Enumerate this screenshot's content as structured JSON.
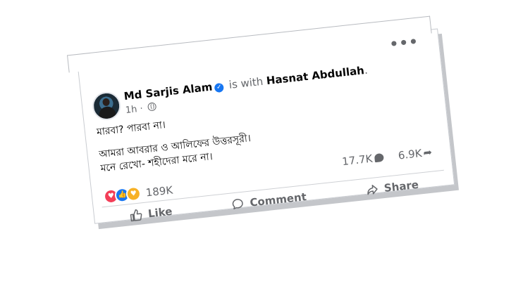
{
  "post": {
    "author": "Md Sarjis Alam",
    "connector": "is with",
    "tagged": "Hasnat Abdullah",
    "time": "1h",
    "text_lines": [
      "মারবা? পারবা না।",
      "আমরা আবরার ও আলিফের উত্তরসূরী।",
      "মনে রেখো- শহীদেরা মরে না।"
    ],
    "reactions_count": "189K",
    "comments_count": "17.7K",
    "shares_count": "6.9K"
  },
  "actions": {
    "like": "Like",
    "comment": "Comment",
    "share": "Share"
  },
  "icons": {
    "more": "more-options-icon",
    "verified": "verified-badge-icon",
    "privacy": "globe-icon",
    "reaction_love": "love-reaction-icon",
    "reaction_like": "like-reaction-icon",
    "reaction_care": "care-reaction-icon"
  },
  "colors": {
    "brand_blue": "#1877f2",
    "text": "#050505",
    "muted": "#65676b"
  }
}
